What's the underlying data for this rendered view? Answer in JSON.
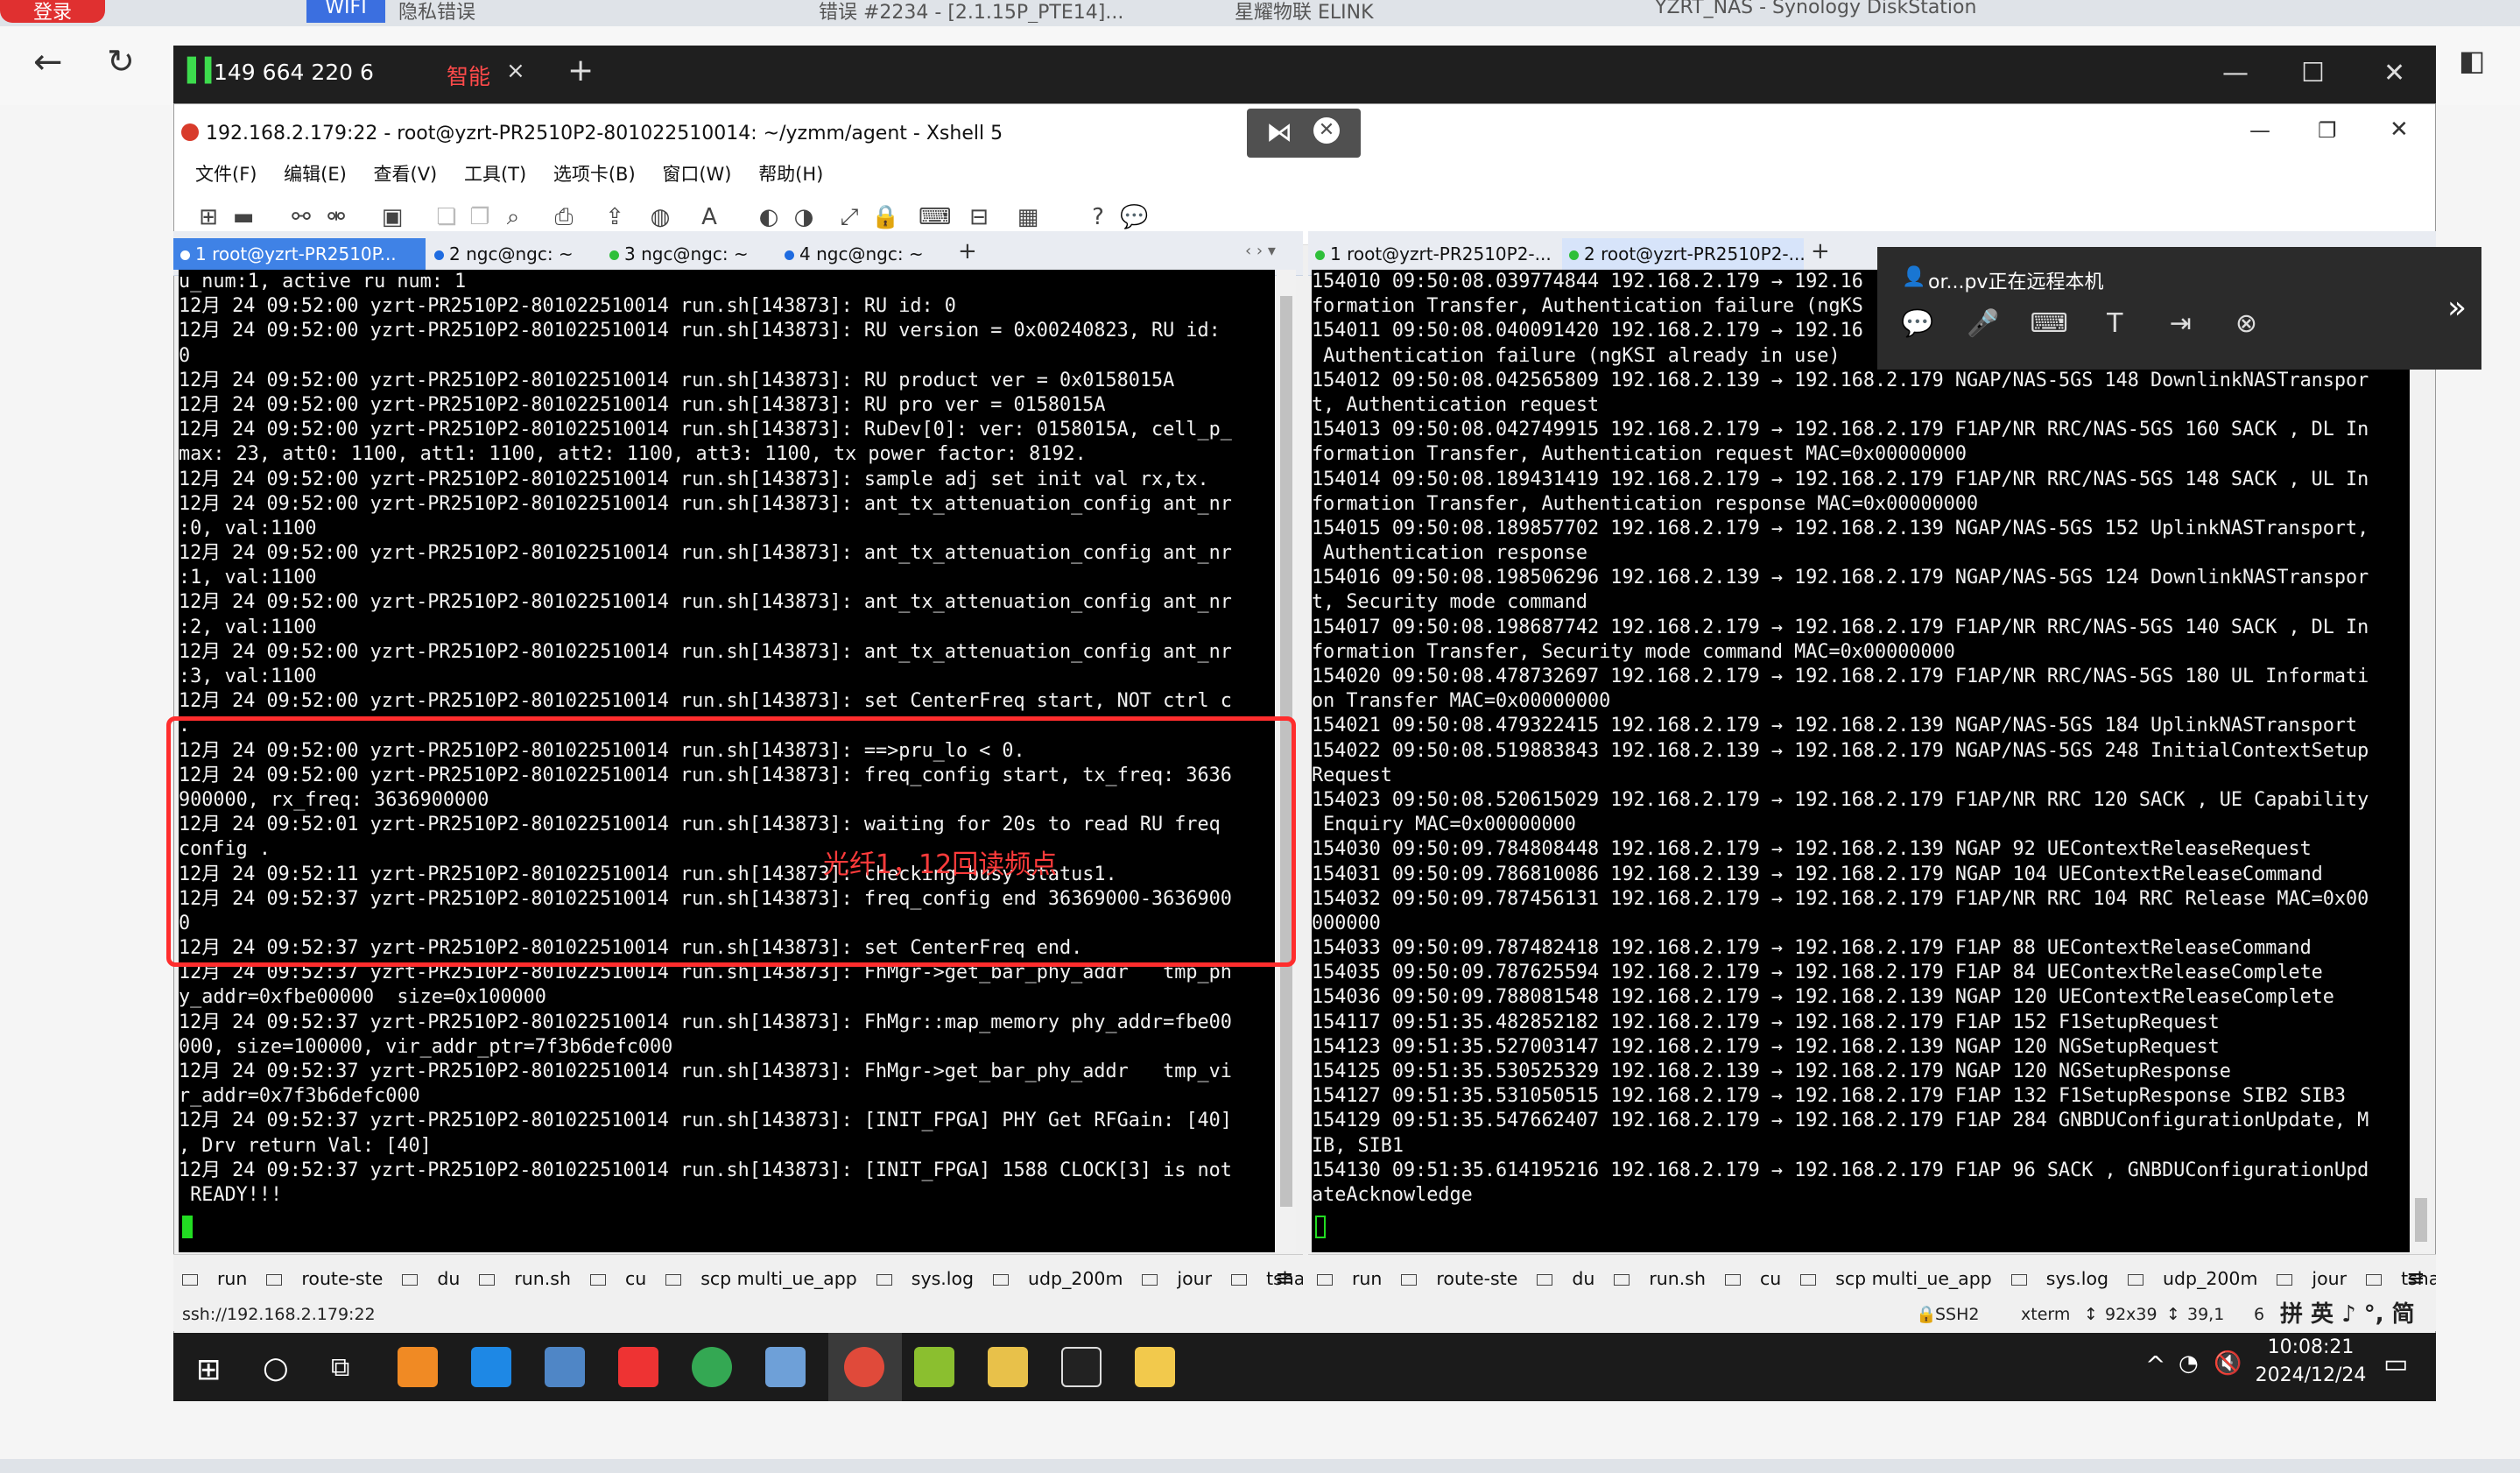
{
  "browser": {
    "tabs": [
      {
        "label": "登录",
        "active": false
      },
      {
        "label": "WIFI",
        "active": false
      },
      {
        "label": "隐私错误",
        "active": false
      },
      {
        "label": "错误 #2234 - [2.1.15P_PTE14]...",
        "active": false
      },
      {
        "label": "星耀物联 ELINK",
        "active": false
      },
      {
        "label": "YZRT_NAS - Synology DiskStation",
        "active": false
      }
    ]
  },
  "remote": {
    "phone": "149 664 220 6",
    "mode": "智能",
    "close": "×",
    "add": "+"
  },
  "xshell": {
    "title": "192.168.2.179:22 - root@yzrt-PR2510P2-801022510014: ~/yzmm/agent - Xshell 5",
    "menu": [
      "文件(F)",
      "编辑(E)",
      "查看(V)",
      "工具(T)",
      "选项卡(B)",
      "窗口(W)",
      "帮助(H)"
    ],
    "left_tabs": [
      {
        "label": "1 root@yzrt-PR2510P...",
        "color": "#ffffff",
        "active": true
      },
      {
        "label": "2 ngc@ngc: ~",
        "color": "#1e6be0",
        "active": false
      },
      {
        "label": "3 ngc@ngc: ~",
        "color": "#2fbf3a",
        "active": false
      },
      {
        "label": "4 ngc@ngc: ~",
        "color": "#1e6be0",
        "active": false
      }
    ],
    "right_tabs": [
      {
        "label": "1 root@yzrt-PR2510P2-...",
        "color": "#2fbf3a",
        "active": false
      },
      {
        "label": "2 root@yzrt-PR2510P2-...",
        "color": "#2fbf3a",
        "active": true
      }
    ],
    "left_terminal": [
      "u_num:1, active ru num: 1",
      "12月 24 09:52:00 yzrt-PR2510P2-801022510014 run.sh[143873]: RU id: 0",
      "12月 24 09:52:00 yzrt-PR2510P2-801022510014 run.sh[143873]: RU version = 0x00240823, RU id:",
      "0",
      "12月 24 09:52:00 yzrt-PR2510P2-801022510014 run.sh[143873]: RU product ver = 0x0158015A",
      "12月 24 09:52:00 yzrt-PR2510P2-801022510014 run.sh[143873]: RU pro ver = 0158015A",
      "12月 24 09:52:00 yzrt-PR2510P2-801022510014 run.sh[143873]: RuDev[0]: ver: 0158015A, cell_p_",
      "max: 23, att0: 1100, att1: 1100, att2: 1100, att3: 1100, tx power factor: 8192.",
      "12月 24 09:52:00 yzrt-PR2510P2-801022510014 run.sh[143873]: sample adj set init val rx,tx.",
      "12月 24 09:52:00 yzrt-PR2510P2-801022510014 run.sh[143873]: ant_tx_attenuation_config ant_nr",
      ":0, val:1100",
      "12月 24 09:52:00 yzrt-PR2510P2-801022510014 run.sh[143873]: ant_tx_attenuation_config ant_nr",
      ":1, val:1100",
      "12月 24 09:52:00 yzrt-PR2510P2-801022510014 run.sh[143873]: ant_tx_attenuation_config ant_nr",
      ":2, val:1100",
      "12月 24 09:52:00 yzrt-PR2510P2-801022510014 run.sh[143873]: ant_tx_attenuation_config ant_nr",
      ":3, val:1100",
      "12月 24 09:52:00 yzrt-PR2510P2-801022510014 run.sh[143873]: set CenterFreq start, NOT ctrl c",
      ".",
      "12月 24 09:52:00 yzrt-PR2510P2-801022510014 run.sh[143873]: ==>pru_lo < 0.",
      "12月 24 09:52:00 yzrt-PR2510P2-801022510014 run.sh[143873]: freq_config start, tx_freq: 3636",
      "900000, rx_freq: 3636900000",
      "12月 24 09:52:01 yzrt-PR2510P2-801022510014 run.sh[143873]: waiting for 20s to read RU freq",
      "config .",
      "12月 24 09:52:11 yzrt-PR2510P2-801022510014 run.sh[143873]: checking busy status1.",
      "12月 24 09:52:37 yzrt-PR2510P2-801022510014 run.sh[143873]: freq_config end 36369000-3636900",
      "0",
      "12月 24 09:52:37 yzrt-PR2510P2-801022510014 run.sh[143873]: set CenterFreq end.",
      "12月 24 09:52:37 yzrt-PR2510P2-801022510014 run.sh[143873]: FhMgr->get_bar_phy_addr   tmp_ph",
      "y_addr=0xfbe00000  size=0x100000",
      "12月 24 09:52:37 yzrt-PR2510P2-801022510014 run.sh[143873]: FhMgr::map_memory phy_addr=fbe00",
      "000, size=100000, vir_addr_ptr=7f3b6defc000",
      "12月 24 09:52:37 yzrt-PR2510P2-801022510014 run.sh[143873]: FhMgr->get_bar_phy_addr   tmp_vi",
      "r_addr=0x7f3b6defc000",
      "12月 24 09:52:37 yzrt-PR2510P2-801022510014 run.sh[143873]: [INIT_FPGA] PHY Get RFGain: [40]",
      ", Drv return Val: [40]",
      "12月 24 09:52:37 yzrt-PR2510P2-801022510014 run.sh[143873]: [INIT_FPGA] 1588 CLOCK[3] is not",
      " READY!!!"
    ],
    "right_terminal": [
      "154010 09:50:08.039774844 192.168.2.179 → 192.16",
      "formation Transfer, Authentication failure (ngKS",
      "154011 09:50:08.040091420 192.168.2.179 → 192.16",
      " Authentication failure (ngKSI already in use)",
      "154012 09:50:08.042565809 192.168.2.139 → 192.168.2.179 NGAP/NAS-5GS 148 DownlinkNASTranspor",
      "t, Authentication request",
      "154013 09:50:08.042749915 192.168.2.179 → 192.168.2.179 F1AP/NR RRC/NAS-5GS 160 SACK , DL In",
      "formation Transfer, Authentication request MAC=0x00000000",
      "154014 09:50:08.189431419 192.168.2.179 → 192.168.2.179 F1AP/NR RRC/NAS-5GS 148 SACK , UL In",
      "formation Transfer, Authentication response MAC=0x00000000",
      "154015 09:50:08.189857702 192.168.2.179 → 192.168.2.139 NGAP/NAS-5GS 152 UplinkNASTransport,",
      " Authentication response",
      "154016 09:50:08.198506296 192.168.2.139 → 192.168.2.179 NGAP/NAS-5GS 124 DownlinkNASTranspor",
      "t, Security mode command",
      "154017 09:50:08.198687742 192.168.2.179 → 192.168.2.179 F1AP/NR RRC/NAS-5GS 140 SACK , DL In",
      "formation Transfer, Security mode command MAC=0x00000000",
      "154020 09:50:08.478732697 192.168.2.179 → 192.168.2.179 F1AP/NR RRC/NAS-5GS 180 UL Informati",
      "on Transfer MAC=0x00000000",
      "154021 09:50:08.479322415 192.168.2.179 → 192.168.2.139 NGAP/NAS-5GS 184 UplinkNASTransport",
      "154022 09:50:08.519883843 192.168.2.139 → 192.168.2.179 NGAP/NAS-5GS 248 InitialContextSetup",
      "Request",
      "154023 09:50:08.520615029 192.168.2.179 → 192.168.2.179 F1AP/NR RRC 120 SACK , UE Capability",
      " Enquiry MAC=0x00000000",
      "154030 09:50:09.784808448 192.168.2.179 → 192.168.2.139 NGAP 92 UEContextReleaseRequest",
      "154031 09:50:09.786810086 192.168.2.139 → 192.168.2.179 NGAP 104 UEContextReleaseCommand",
      "154032 09:50:09.787456131 192.168.2.179 → 192.168.2.179 F1AP/NR RRC 104 RRC Release MAC=0x00",
      "000000",
      "154033 09:50:09.787482418 192.168.2.179 → 192.168.2.179 F1AP 88 UEContextReleaseCommand",
      "154035 09:50:09.787625594 192.168.2.179 → 192.168.2.179 F1AP 84 UEContextReleaseComplete",
      "154036 09:50:09.788081548 192.168.2.179 → 192.168.2.139 NGAP 120 UEContextReleaseComplete",
      "154117 09:51:35.482852182 192.168.2.179 → 192.168.2.179 F1AP 152 F1SetupRequest",
      "154123 09:51:35.527003147 192.168.2.179 → 192.168.2.139 NGAP 120 NGSetupRequest",
      "154125 09:51:35.530525329 192.168.2.139 → 192.168.2.179 NGAP 120 NGSetupResponse",
      "154127 09:51:35.531050515 192.168.2.179 → 192.168.2.179 F1AP 132 F1SetupResponse SIB2 SIB3",
      "154129 09:51:35.547662407 192.168.2.179 → 192.168.2.179 F1AP 284 GNBDUConfigurationUpdate, M",
      "IB, SIB1",
      "154130 09:51:35.614195216 192.168.2.179 → 192.168.2.179 F1AP 96 SACK , GNBDUConfigurationUpd",
      "ateAcknowledge"
    ],
    "quick_commands": [
      "run",
      "route-ste",
      "du",
      "run.sh",
      "cu",
      "scp multi_ue_app",
      "sys.log",
      "udp_200m",
      "jour",
      "tshark"
    ],
    "status": {
      "left": "ssh://192.168.2.179:22",
      "protocol": "SSH2",
      "term": "xterm",
      "size": "92x39",
      "cursor": "39,1",
      "sessions": "6"
    }
  },
  "annotation": {
    "label": "光纤1，12回读频点",
    "color": "#ff2d2d"
  },
  "popup": {
    "text": "or...pv正在远程本机"
  },
  "taskbar": {
    "time": "10:08:21",
    "date": "2024/12/24",
    "ime": "拼 英 ♪ °, 简"
  }
}
